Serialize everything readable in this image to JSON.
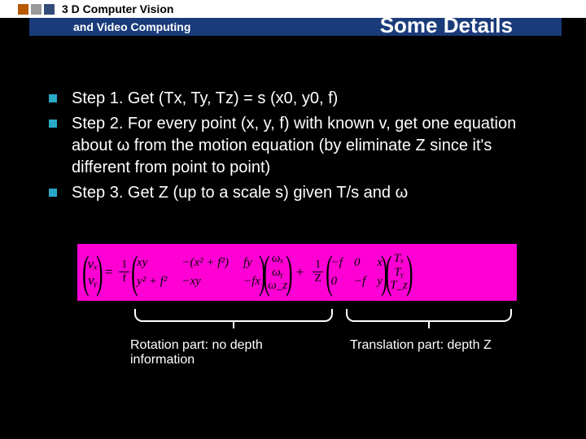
{
  "header": {
    "line1": "3 D Computer Vision",
    "line2": "and Video Computing",
    "slide_title": "Some Details"
  },
  "bullets": [
    "Step 1. Get (Tx, Ty, Tz) = s (x0, y0, f)",
    "Step 2. For every point (x, y, f) with known v, get one equation about ω from the motion equation  (by eliminate Z since it's different from point to point)",
    "Step 3. Get Z (up to a scale s) given T/s and ω"
  ],
  "equation": {
    "lhs_top": "vₓ",
    "lhs_bot": "vᵧ",
    "coef1_num": "1",
    "coef1_den": "f",
    "m11": "xy",
    "m12": "−(x² + f²)",
    "m13": "fy",
    "m21": "y² + f²",
    "m22": "−xy",
    "m23": "−fx",
    "omega_x": "ωₓ",
    "omega_y": "ωᵧ",
    "omega_z": "ω_z",
    "plus": "+",
    "coef2_num": "1",
    "coef2_den": "Z",
    "n11": "−f",
    "n12": "0",
    "n13": "x",
    "n21": "0",
    "n22": "−f",
    "n23": "y",
    "t_x": "Tₓ",
    "t_y": "Tᵧ",
    "t_z": "T_z"
  },
  "captions": {
    "rotation": "Rotation part: no depth information",
    "translation": "Translation part: depth Z"
  }
}
